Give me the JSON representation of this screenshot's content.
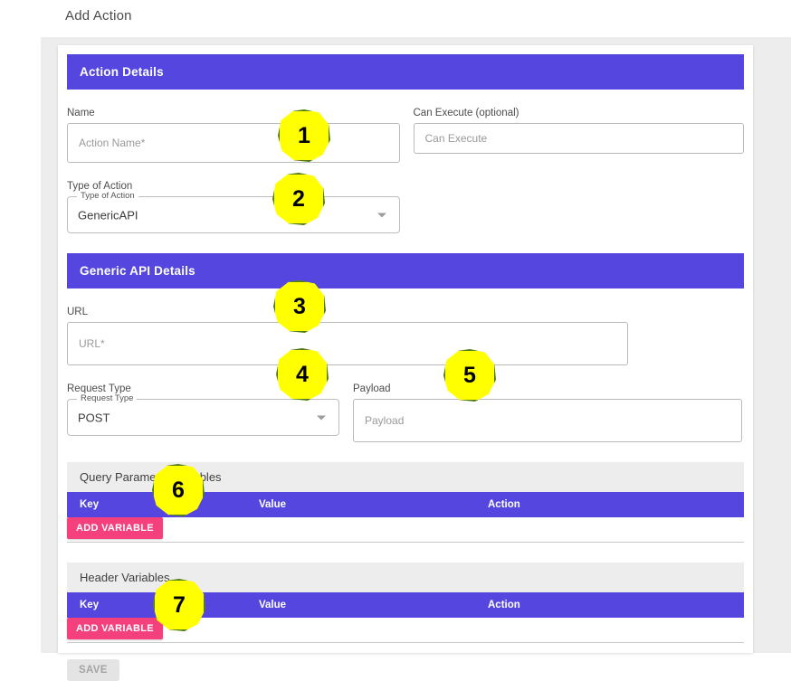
{
  "page": {
    "title": "Add Action"
  },
  "sections": {
    "action_details": {
      "banner": "Action Details",
      "name": {
        "label": "Name",
        "placeholder": "Action Name*",
        "value": ""
      },
      "can_execute": {
        "label": "Can Execute (optional)",
        "placeholder": "Can Execute",
        "value": ""
      },
      "type_of_action": {
        "label": "Type of Action",
        "legend": "Type of Action",
        "selected": "GenericAPI"
      }
    },
    "generic_api_details": {
      "banner": "Generic API Details",
      "url": {
        "label": "URL",
        "placeholder": "URL*",
        "value": ""
      },
      "request_type": {
        "label": "Request Type",
        "legend": "Request Type",
        "selected": "POST"
      },
      "payload": {
        "label": "Payload",
        "placeholder": "Payload",
        "value": ""
      }
    },
    "query_parameter_variables": {
      "title": "Query Parameter Variables",
      "columns": [
        "Key",
        "Value",
        "Action"
      ],
      "rows": [],
      "add_button": "ADD VARIABLE"
    },
    "header_variables": {
      "title": "Header Variables",
      "columns": [
        "Key",
        "Value",
        "Action"
      ],
      "rows": [],
      "add_button": "ADD VARIABLE"
    }
  },
  "footer": {
    "save_label": "SAVE",
    "save_disabled": true
  },
  "callouts": [
    {
      "number": "1",
      "target": "name-input"
    },
    {
      "number": "2",
      "target": "type-of-action-select"
    },
    {
      "number": "3",
      "target": "url-input"
    },
    {
      "number": "4",
      "target": "request-type-select"
    },
    {
      "number": "5",
      "target": "payload-input"
    },
    {
      "number": "6",
      "target": "query-add-variable-button"
    },
    {
      "number": "7",
      "target": "header-add-variable-button"
    }
  ],
  "colors": {
    "banner_purple": "#5546e0",
    "accent_pink": "#f4417e",
    "page_bg": "#ededed",
    "badge_yellow": "#ffff00",
    "badge_border": "#4e7a1e"
  }
}
